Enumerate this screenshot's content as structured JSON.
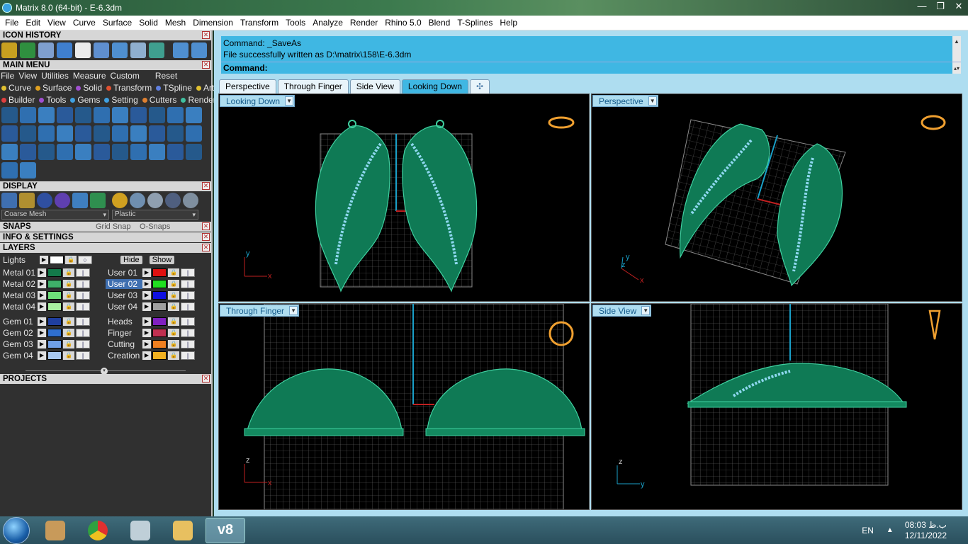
{
  "window": {
    "title": "Matrix 8.0 (64-bit) - E-6.3dm",
    "controls": [
      "—",
      "❐",
      "✕"
    ]
  },
  "menubar": [
    "File",
    "Edit",
    "View",
    "Curve",
    "Surface",
    "Solid",
    "Mesh",
    "Dimension",
    "Transform",
    "Tools",
    "Analyze",
    "Render",
    "Rhino 5.0",
    "Blend",
    "T-Splines",
    "Help"
  ],
  "panels": {
    "icon_history": "ICON HISTORY",
    "main_menu": "MAIN MENU",
    "display": "DISPLAY",
    "snaps": "SNAPS",
    "info_settings": "INFO & SETTINGS",
    "layers": "LAYERS",
    "projects": "PROJECTS"
  },
  "main_menu_items": [
    "File",
    "View",
    "Utilities",
    "Measure",
    "Custom"
  ],
  "main_menu_reset": "Reset",
  "categories_row1": [
    {
      "label": "Curve",
      "color": "#e0c030"
    },
    {
      "label": "Surface",
      "color": "#e0a020"
    },
    {
      "label": "Solid",
      "color": "#a050d0"
    },
    {
      "label": "Transform",
      "color": "#e05030"
    },
    {
      "label": "TSpline",
      "color": "#6080e0"
    },
    {
      "label": "Art",
      "color": "#e0c030"
    }
  ],
  "categories_row2": [
    {
      "label": "Builder",
      "color": "#e04040"
    },
    {
      "label": "Tools",
      "color": "#a050d0"
    },
    {
      "label": "Gems",
      "color": "#40a0e0"
    },
    {
      "label": "Setting",
      "color": "#40a0e0"
    },
    {
      "label": "Cutters",
      "color": "#e08030"
    },
    {
      "label": "Render",
      "color": "#40c0a0"
    }
  ],
  "display": {
    "mesh_quality": "Coarse Mesh",
    "material": "Plastic"
  },
  "snaps": {
    "grid_snap": "Grid Snap",
    "osnaps": "O-Snaps"
  },
  "layers": {
    "lights": "Lights",
    "hide": "Hide",
    "show": "Show",
    "left": [
      {
        "name": "Metal 01",
        "color": "#137a4a"
      },
      {
        "name": "Metal 02",
        "color": "#3fb06a"
      },
      {
        "name": "Metal 03",
        "color": "#6ee07a"
      },
      {
        "name": "Metal 04",
        "color": "#a8f0a0"
      },
      {
        "name": "Gem 01",
        "color": "#1f3fa0"
      },
      {
        "name": "Gem 02",
        "color": "#2f6fd0"
      },
      {
        "name": "Gem 03",
        "color": "#6fa0e8"
      },
      {
        "name": "Gem 04",
        "color": "#a8c8f0"
      }
    ],
    "right": [
      {
        "name": "User 01",
        "color": "#e01010",
        "selected": false
      },
      {
        "name": "User 02",
        "color": "#20e020",
        "selected": true
      },
      {
        "name": "User 03",
        "color": "#1010e0",
        "selected": false
      },
      {
        "name": "User 04",
        "color": "#a0a0a0",
        "selected": false
      },
      {
        "name": "Heads",
        "color": "#8020c0",
        "selected": false
      },
      {
        "name": "Finger",
        "color": "#c03050",
        "selected": false
      },
      {
        "name": "Cutting",
        "color": "#f08020",
        "selected": false
      },
      {
        "name": "Creation",
        "color": "#f0b020",
        "selected": false
      }
    ]
  },
  "command": {
    "line1": "Command: _SaveAs",
    "line2": "File successfully written as D:\\matrix\\158\\E-6.3dm",
    "prompt": "Command:"
  },
  "tabs": [
    "Perspective",
    "Through Finger",
    "Side View",
    "Looking Down"
  ],
  "active_tab": "Looking Down",
  "viewports": [
    {
      "label": "Looking Down",
      "axes": [
        "y",
        "x"
      ]
    },
    {
      "label": "Perspective",
      "axes": [
        "z",
        "y",
        "x"
      ]
    },
    {
      "label": "Through Finger",
      "axes": [
        "z",
        "x"
      ]
    },
    {
      "label": "Side View",
      "axes": [
        "z",
        "y"
      ]
    }
  ],
  "taskbar": {
    "lang": "EN",
    "time": "08:03 ب.ظ",
    "date": "12/11/2022",
    "active_app": "v8"
  }
}
